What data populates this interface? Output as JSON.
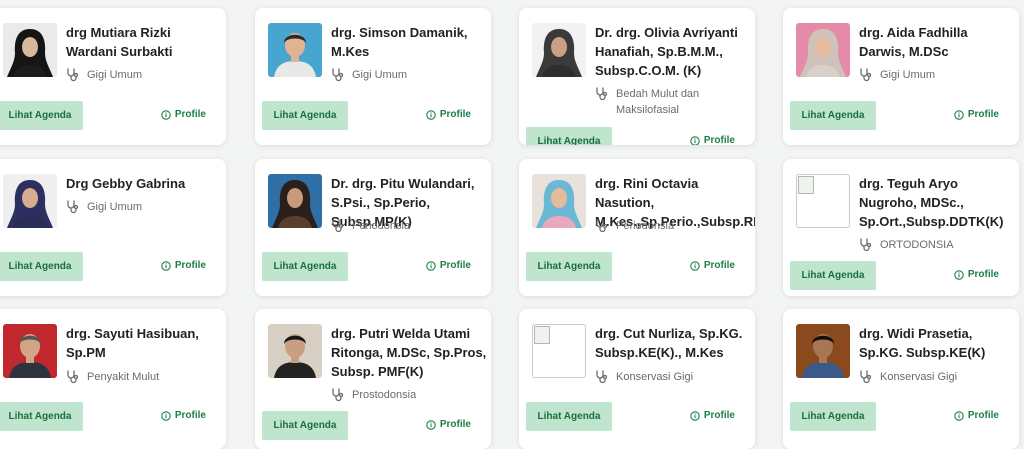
{
  "labels": {
    "agenda": "Lihat Agenda",
    "profile": "Profile"
  },
  "doctors": [
    {
      "name": "drg Mutiara Rizki Wardani Surbakti",
      "specialty": "Gigi Umum"
    },
    {
      "name": "drg. Simson Damanik, M.Kes",
      "specialty": "Gigi Umum"
    },
    {
      "name": "Dr. drg. Olivia Avriyanti Hanafiah, Sp.B.M.M., Subsp.C.O.M. (K)",
      "specialty": "Bedah Mulut dan Maksilofasial"
    },
    {
      "name": "drg. Aida Fadhilla Darwis, M.DSc",
      "specialty": "Gigi Umum"
    },
    {
      "name": "Drg Gebby Gabrina",
      "specialty": "Gigi Umum"
    },
    {
      "name": "Dr. drg. Pitu Wulandari, S.Psi., Sp.Perio, Subsp.MP(K)",
      "specialty": "Periodonsia"
    },
    {
      "name": "drg. Rini Octavia Nasution, M.Kes.,Sp.Perio.,Subsp.RPID(K)",
      "specialty": "Periodonsia"
    },
    {
      "name": "drg. Teguh Aryo Nugroho, MDSc., Sp.Ort.,Subsp.DDTK(K)",
      "specialty": "ORTODONSIA"
    },
    {
      "name": "drg. Sayuti Hasibuan, Sp.PM",
      "specialty": "Penyakit Mulut"
    },
    {
      "name": "drg. Putri Welda Utami Ritonga, M.DSc, Sp.Pros, Subsp. PMF(K)",
      "specialty": "Prostodonsia"
    },
    {
      "name": "drg. Cut Nurliza, Sp.KG. Subsp.KE(K)., M.Kes",
      "specialty": "Konservasi Gigi"
    },
    {
      "name": "drg. Widi Prasetia, Sp.KG. Subsp.KE(K)",
      "specialty": "Konservasi Gigi"
    }
  ]
}
